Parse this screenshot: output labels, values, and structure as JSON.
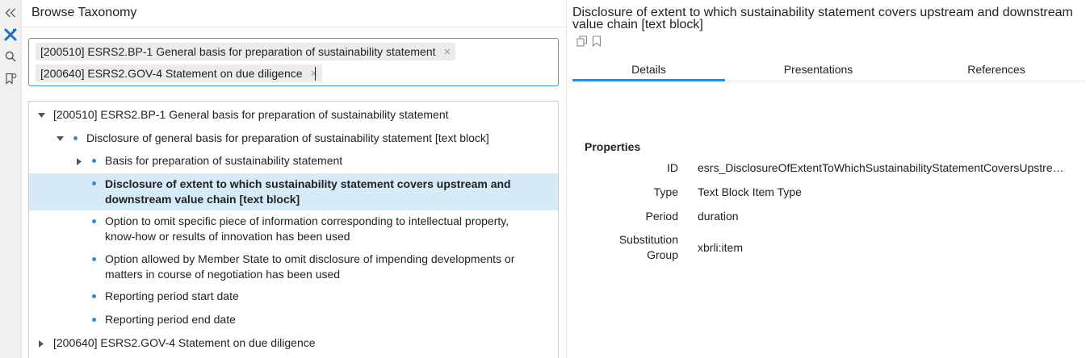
{
  "browse_panel": {
    "title": "Browse Taxonomy",
    "selected_chips": [
      {
        "label": "[200510] ESRS2.BP-1 General basis for preparation of sustainability statement",
        "remove": "×"
      },
      {
        "label": "[200640] ESRS2.GOV-4 Statement on due diligence",
        "remove": "×"
      }
    ],
    "tree": [
      {
        "label": "[200510] ESRS2.BP-1 General basis for preparation of sustainability statement",
        "level": 0,
        "toggle": "expanded"
      },
      {
        "label": "Disclosure of general basis for preparation of sustainability statement [text block]",
        "level": 1,
        "toggle": "expanded"
      },
      {
        "label": "Basis for preparation of sustainability statement",
        "level": 2,
        "toggle": "collapsed"
      },
      {
        "line1": "Disclosure of extent to which sustainability statement covers upstream and",
        "line2": "downstream value chain [text block]",
        "level": 2,
        "selected": true
      },
      {
        "line1": "Option to omit specific piece of information corresponding to intellectual property,",
        "line2": "know-how or results of innovation has been used",
        "level": 2
      },
      {
        "line1": "Option allowed by Member State to omit disclosure of impending developments or",
        "line2": "matters in course of negotiation has been used",
        "level": 2
      },
      {
        "label": "Reporting period start date",
        "level": 2
      },
      {
        "label": "Reporting period end date",
        "level": 2
      },
      {
        "label": "[200640] ESRS2.GOV-4 Statement on due diligence",
        "level": 0,
        "toggle": "collapsed"
      }
    ]
  },
  "details_panel": {
    "title": "Disclosure of extent to which sustainability statement covers upstream and downstream value chain [text block]",
    "tabs": [
      "Details",
      "Presentations",
      "References"
    ],
    "active_tab": "Details",
    "properties_heading": "Properties",
    "properties": [
      {
        "key": "ID",
        "value": "esrs_DisclosureOfExtentToWhichSustainabilityStatementCoversUpstream..."
      },
      {
        "key": "Type",
        "value": "Text Block Item Type"
      },
      {
        "key": "Period",
        "value": "duration"
      },
      {
        "key1": "Substitution",
        "key2": "Group",
        "value": "xbrli:item"
      }
    ]
  },
  "colors": {
    "accent": "#2b8fd8",
    "selected_row": "#d6eaf8",
    "rail": "#f0f0f0"
  },
  "icons": {
    "rail": [
      "collapse-left-icon",
      "xbrl-logo-icon",
      "search-icon",
      "bookmark-list-icon"
    ],
    "detail_actions": [
      "copy-icon",
      "bookmark-icon"
    ]
  }
}
